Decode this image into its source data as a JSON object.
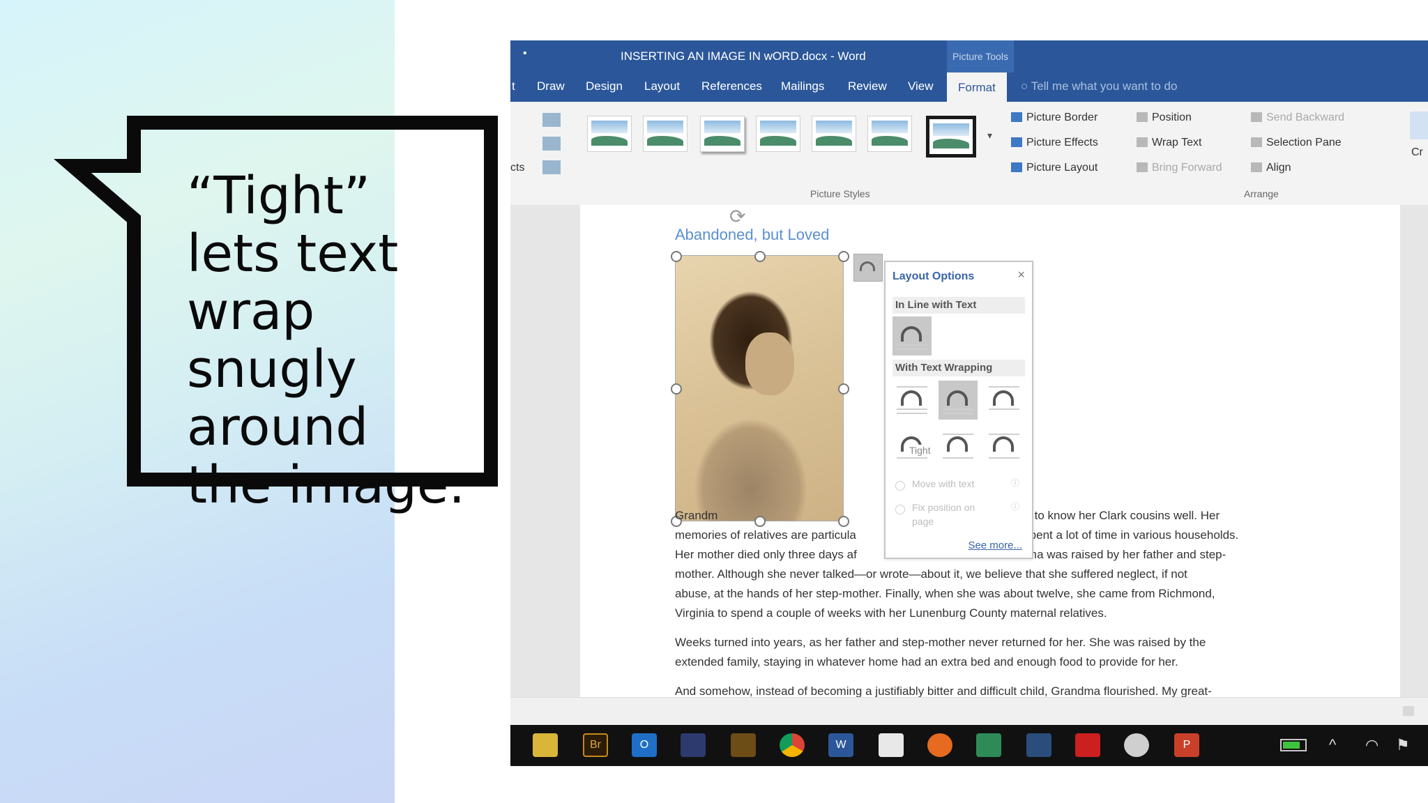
{
  "callout": {
    "lines": [
      "“Tight”",
      "lets text",
      "wrap",
      "snugly",
      "around",
      "the image."
    ]
  },
  "word": {
    "qat_symbol": "•",
    "document_title": "INSERTING AN IMAGE IN wORD.docx  -  Word",
    "context_tab": "Picture Tools",
    "tabs": [
      "Draw",
      "Design",
      "Layout",
      "References",
      "Mailings",
      "Review",
      "View",
      "Format"
    ],
    "tab_edge_label": "t",
    "active_tab": "Format",
    "tell_me": "Tell me what you want to do",
    "ribbon": {
      "left_cut_label": "cts",
      "picture_styles_label": "Picture Styles",
      "arrange_label": "Arrange",
      "picture_border": "Picture Border",
      "picture_effects": "Picture Effects",
      "picture_layout": "Picture Layout",
      "position": "Position",
      "wrap_text": "Wrap Text",
      "bring_forward": "Bring Forward",
      "send_backward": "Send Backward",
      "selection_pane": "Selection Pane",
      "align": "Align",
      "crop_cut": "Cr"
    },
    "document": {
      "heading": "Abandoned, but Loved",
      "line1_left": "Grandm",
      "line1_right": "on to know her Clark cousins well. Her",
      "line2_left": "memories of relatives are particula",
      "line2_right": "e spent a lot of time in various households.",
      "line3_left": "Her mother died only three days af",
      "line3_right": "ndma was raised by her father and step-",
      "line4": "mother. Although she never talked—or wrote—about it, we believe that she suffered neglect, if not",
      "line5": "abuse, at the hands of her step-mother. Finally, when she was about twelve, she came from Richmond,",
      "line6": "Virginia to spend a couple of weeks with her Lunenburg County maternal relatives.",
      "line7": " Weeks turned into years, as her father and step-mother never returned for her. She was raised by the",
      "line8": "extended family, staying in whatever home had an extra bed and enough food to provide for her.",
      "line9": "And somehow, instead of becoming a justifiably bitter and difficult child, Grandma flourished. My great-"
    },
    "layout_options": {
      "title": "Layout Options",
      "close": "×",
      "inline_section": "In Line with Text",
      "wrapping_section": "With Text Wrapping",
      "tooltip": "Tight",
      "move_with_text": "Move with text",
      "fix_position_1": "Fix position on",
      "fix_position_2": "page",
      "info_symbol": "ⓘ",
      "see_more": "See more..."
    }
  },
  "taskbar": {
    "apps": [
      "file-explorer",
      "bridge",
      "outlook",
      "app-blue",
      "app-gold",
      "chrome",
      "word",
      "skype",
      "firefox",
      "tree-app",
      "photos",
      "creative-cloud",
      "app-cloud",
      "powerpoint"
    ],
    "bridge_label": "Br",
    "word_label": "W",
    "outlook_label": "O",
    "powerpoint_label": "P",
    "tray_up": "^",
    "tray_wifi": "◠",
    "tray_flag": "⚑"
  },
  "colors": {
    "word_blue": "#2b579a",
    "link_blue": "#3864a8",
    "heading_blue": "#5a8fd0"
  }
}
